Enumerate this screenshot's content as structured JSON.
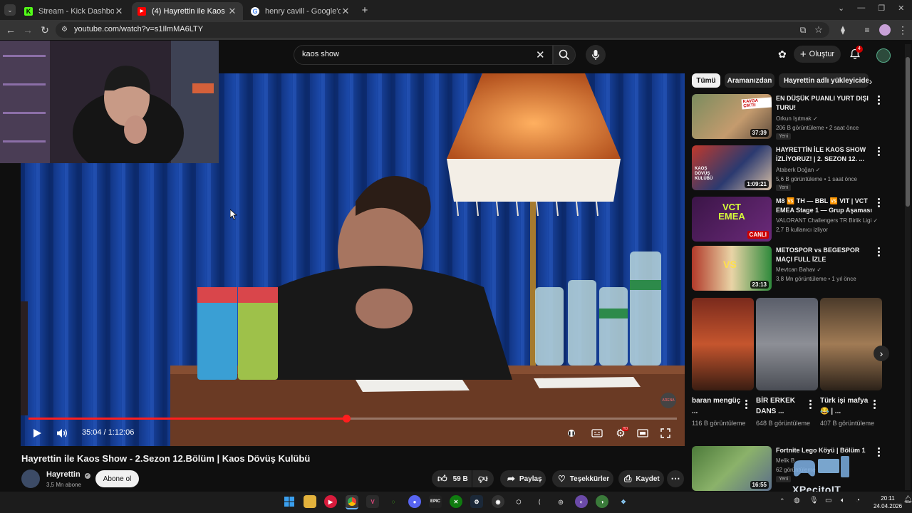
{
  "browser": {
    "tabs": [
      {
        "title": "Stream - Kick Dashboard",
        "active": false
      },
      {
        "title": "(4) Hayrettin ile Kaos Show - 2.Sezon",
        "active": true
      },
      {
        "title": "henry cavill - Google'da Ara",
        "active": false
      }
    ],
    "url": "youtube.com/watch?v=s1IlmMA6LTY"
  },
  "masthead": {
    "search_query": "kaos show",
    "create_label": "Oluştur",
    "notification_count": "4"
  },
  "player": {
    "time": "35:04 / 1:12:06",
    "progress": 0.49,
    "video_logo_text": "ARENA"
  },
  "video": {
    "title": "Hayrettin ile Kaos Show - 2.Sezon 12.Bölüm | Kaos Dövüş Kulübü",
    "channel": "Hayrettin",
    "subscribers": "3,5 Mn abone",
    "subscribe_label": "Abone ol",
    "likes": "59 B",
    "share_label": "Paylaş",
    "thanks_label": "Teşekkürler",
    "save_label": "Kaydet"
  },
  "sidebar": {
    "chips": [
      "Tümü",
      "Aramanızdan",
      "Hayrettin adlı yükleyicide"
    ],
    "recommendations": [
      {
        "title": "EN DÜŞÜK PUANLI YURT DIŞI TURU!",
        "channel": "Orkun Işıtmak",
        "meta": "206 B görüntüleme • 2 saat önce",
        "badge": "Yeni",
        "duration": "37:39",
        "thumb_text": "KAVGA ÇIKTI!"
      },
      {
        "title": "HAYRETTİN İLE KAOS SHOW İZLİYORUZ! | 2. SEZON 12. ...",
        "channel": "Ataberk Doğan",
        "meta": "5,6 B görüntüleme • 1 saat önce",
        "badge": "Yeni",
        "duration": "1:09:21",
        "thumb_text": "KAOS DÖVÜŞ KULÜBÜ"
      },
      {
        "title": "M8 🆚 TH — BBL 🆚 VIT | VCT EMEA Stage 1 — Grup Aşaması",
        "channel": "VALORANT Challengers TR Birlik Ligi",
        "meta": "2,7 B kullanıcı izliyor",
        "badge": "",
        "duration": "",
        "live_label": "CANLI",
        "thumb_text": "VCT EMEA"
      },
      {
        "title": "METOSPOR vs BEGESPOR MAÇI FULL İZLE",
        "channel": "Mevtcan Bahav",
        "meta": "3,8 Mn görüntüleme • 1 yıl önce",
        "badge": "",
        "duration": "23:13",
        "thumb_text": "VS"
      }
    ],
    "shorts": [
      {
        "title": "baran mengüç ...",
        "views": "116 B görüntüleme"
      },
      {
        "title": "BİR ERKEK DANS ...",
        "views": "648 B görüntüleme"
      },
      {
        "title": "Türk işi mafya 😂 | ...",
        "views": "407 B görüntüleme"
      }
    ],
    "last": {
      "title": "Fortnite Lego Köyü | Bölüm 1",
      "channel": "Melik B",
      "meta": "62 görüntüleme",
      "badge": "Yeni",
      "duration": "16:55"
    }
  },
  "taskbar": {
    "time": "20:11",
    "date": "24.04.2026"
  },
  "watermark": "XPecitoIT"
}
